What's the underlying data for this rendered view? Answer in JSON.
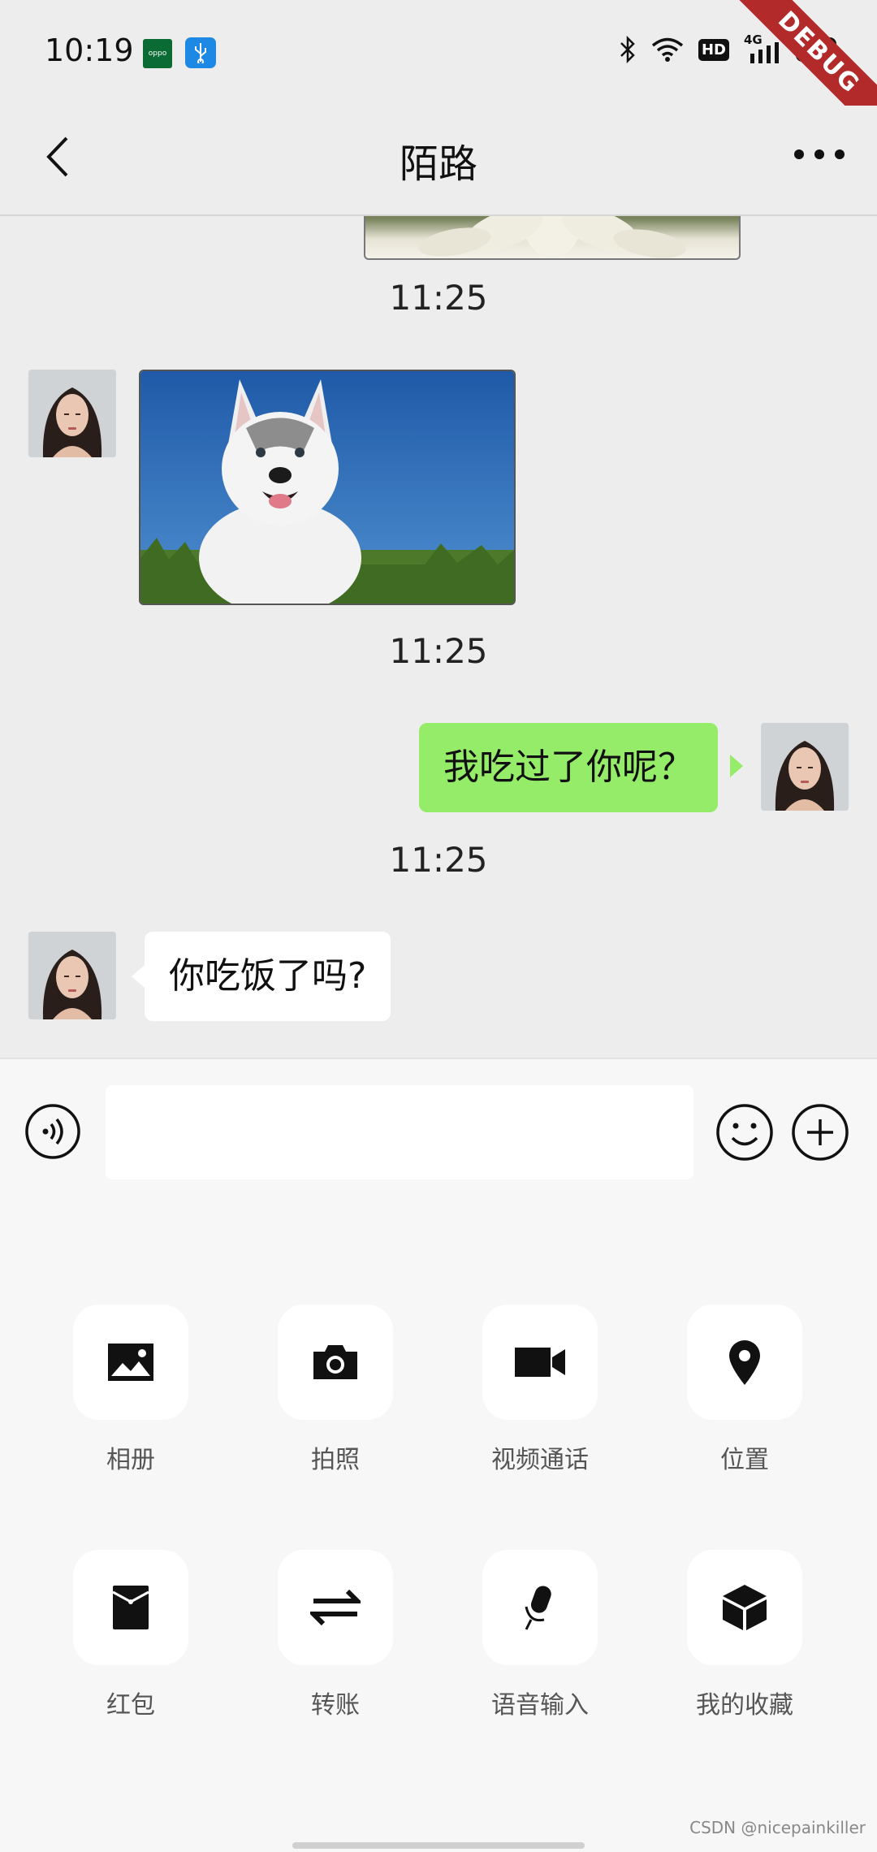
{
  "status": {
    "time": "10:19",
    "oppo_label": "oppo",
    "battery": "100",
    "network": "4G",
    "hd": "HD",
    "debug_banner": "DEBUG"
  },
  "header": {
    "title": "陌路"
  },
  "messages": {
    "ts1": "11:25",
    "ts2": "11:25",
    "ts3": "11:25",
    "sent_text": "我吃过了你呢？",
    "received_text": "你吃饭了吗?"
  },
  "input": {
    "value": ""
  },
  "actions": [
    {
      "label": "相册",
      "icon": "image-icon"
    },
    {
      "label": "拍照",
      "icon": "camera-icon"
    },
    {
      "label": "视频通话",
      "icon": "video-icon"
    },
    {
      "label": "位置",
      "icon": "location-icon"
    },
    {
      "label": "红包",
      "icon": "red-packet-icon"
    },
    {
      "label": "转账",
      "icon": "transfer-icon"
    },
    {
      "label": "语音输入",
      "icon": "microphone-icon"
    },
    {
      "label": "我的收藏",
      "icon": "cube-icon"
    }
  ],
  "watermark": "CSDN @nicepainkiller"
}
